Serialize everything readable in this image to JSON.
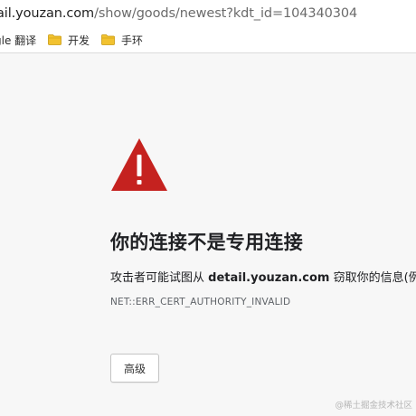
{
  "address_bar": {
    "domain_part": "ail.youzan.com",
    "path_part": "/show/goods/newest?kdt_id=104340304"
  },
  "bookmarks": [
    {
      "label": "gle 翻译",
      "icon": "none"
    },
    {
      "label": "开发",
      "icon": "folder-icon"
    },
    {
      "label": "手环",
      "icon": "folder-icon"
    }
  ],
  "interstitial": {
    "icon": "warning-triangle-icon",
    "headline": "你的连接不是专用连接",
    "description_prefix": "攻击者可能试图从 ",
    "description_domain": "detail.youzan.com",
    "description_suffix": " 窃取你的信息(例如,",
    "error_code": "NET::ERR_CERT_AUTHORITY_INVALID",
    "advanced_button": "高级"
  },
  "watermark": "@稀土掘金技术社区",
  "colors": {
    "warning_red": "#c5221f",
    "folder_yellow": "#f2c230",
    "background": "#f7f7f7"
  }
}
